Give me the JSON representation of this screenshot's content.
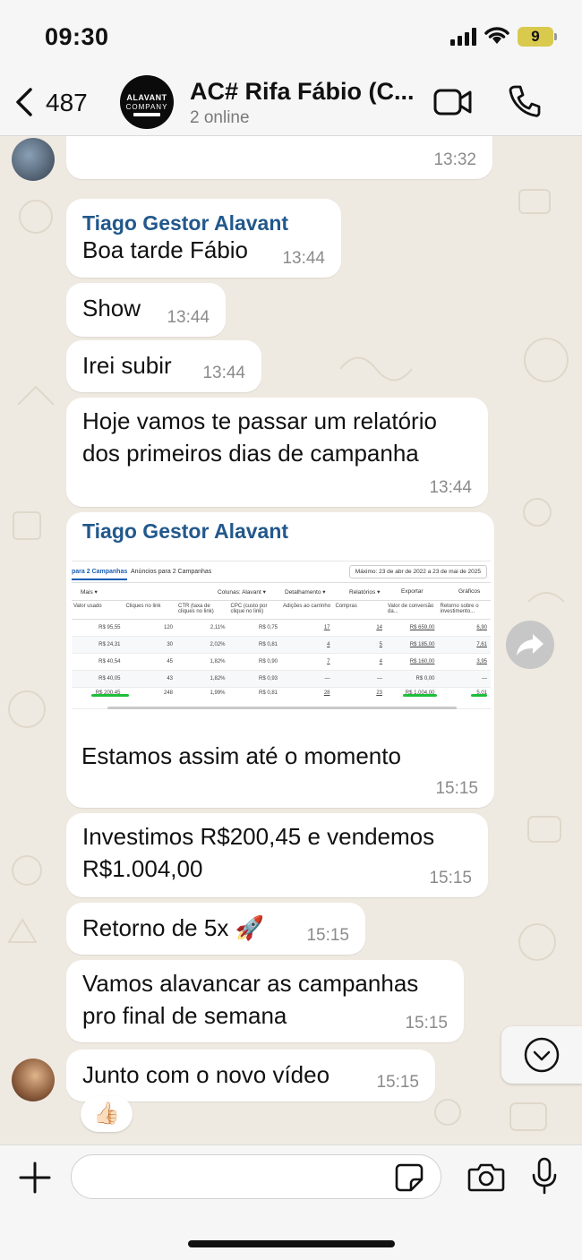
{
  "status": {
    "time": "09:30",
    "battery": "9"
  },
  "header": {
    "unread_count": "487",
    "avatar_line1": "ALAVANT",
    "avatar_line2": "COMPANY",
    "title": "AC# Rifa Fábio (C...",
    "subtitle": "2 online"
  },
  "messages": [
    {
      "time": "13:32"
    },
    {
      "sender": "Tiago Gestor Alavant",
      "text": "Boa tarde Fábio",
      "time": "13:44"
    },
    {
      "text": "Show",
      "time": "13:44"
    },
    {
      "text": "Irei subir",
      "time": "13:44"
    },
    {
      "text": "Hoje vamos te passar um relatório dos primeiros dias de campanha",
      "time": "13:44"
    },
    {
      "sender": "Tiago Gestor Alavant",
      "text": "Estamos assim até o momento",
      "time": "15:15"
    },
    {
      "text": "Investimos R$200,45 e vendemos R$1.004,00",
      "time": "15:15"
    },
    {
      "text": "Retorno de 5x 🚀",
      "time": "15:15"
    },
    {
      "text": "Vamos alavancar as campanhas pro final de semana",
      "time": "15:15"
    },
    {
      "text": "Junto com o novo vídeo",
      "time": "15:15",
      "reaction": "👍🏻"
    }
  ],
  "report": {
    "tab_active": "para 2 Campanhas",
    "tab_other": "Anúncios para 2 Campanhas",
    "date_range": "Máximo: 23 de abr de 2022 a 23 de mai de 2025",
    "toolbar": {
      "more": "Mais ▾",
      "columns": "Colunas: Alavant ▾",
      "breakdown": "Detalhamento ▾",
      "reports": "Relatórios ▾",
      "export": "Exportar",
      "charts": "Gráficos"
    },
    "headers": [
      "Valor usado",
      "Cliques no link",
      "CTR (taxa de cliques no link)",
      "CPC (custo por clique no link)",
      "Adições ao carrinho",
      "Compras",
      "Valor de conversão da...",
      "Retorno sobre o investimento..."
    ],
    "rows": [
      [
        "R$ 95,55",
        "120",
        "2,11%",
        "R$ 0,75",
        "17",
        "14",
        "R$ 659,00",
        "6,90"
      ],
      [
        "R$ 24,31",
        "30",
        "2,02%",
        "R$ 0,81",
        "4",
        "5",
        "R$ 185,00",
        "7,61"
      ],
      [
        "R$ 40,54",
        "45",
        "1,82%",
        "R$ 0,90",
        "7",
        "4",
        "R$ 160,00",
        "3,95"
      ],
      [
        "R$ 40,05",
        "43",
        "1,82%",
        "R$ 0,93",
        "—",
        "—",
        "R$ 0,00",
        "—"
      ]
    ],
    "totals": [
      "R$ 200,45",
      "248",
      "1,99%",
      "R$ 0,81",
      "28",
      "23",
      "R$ 1.004,00",
      "5,01"
    ],
    "total_labels": [
      "Total usado",
      "Total",
      "Por impressões",
      "Por ação",
      "Total",
      "Total",
      "Total",
      "Média"
    ]
  },
  "input": {
    "placeholder": ""
  }
}
